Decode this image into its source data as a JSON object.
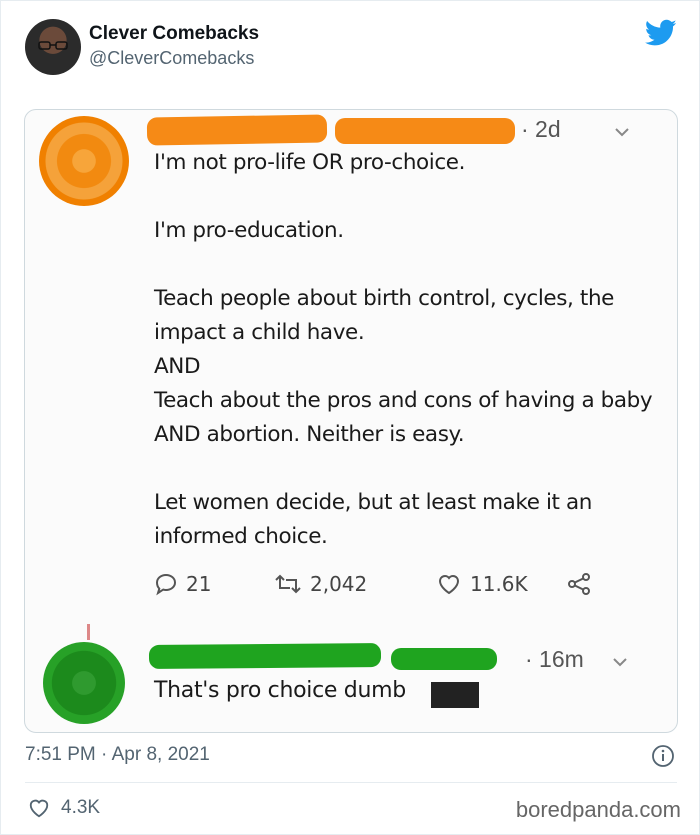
{
  "tweet": {
    "author_name": "Clever Comebacks",
    "author_handle": "@CleverComebacks",
    "timestamp": "7:51 PM · Apr 8, 2021",
    "like_count": "4.3K"
  },
  "screenshot": {
    "post": {
      "time": "· 2d",
      "paragraphs": [
        "I'm not pro-life OR pro-choice.",
        "I'm pro-education.",
        "Teach people about birth control, cycles, the impact a child have.\nAND\nTeach about the pros and cons of having a baby AND abortion. Neither is easy.",
        "Let women decide, but at least make it an informed choice."
      ],
      "reply_count": "21",
      "retweet_count": "2,042",
      "like_count": "11.6K"
    },
    "reply": {
      "time": "· 16m",
      "text": "That's pro choice dumb"
    }
  },
  "watermark": "boredpanda.com",
  "icons": {
    "brand": "twitter-bird-icon",
    "info": "info-icon",
    "like": "heart-icon"
  },
  "colors": {
    "twitter_blue": "#1d9bf0",
    "orange_scribble": "#f68a16",
    "green_scribble": "#1fa41f"
  }
}
